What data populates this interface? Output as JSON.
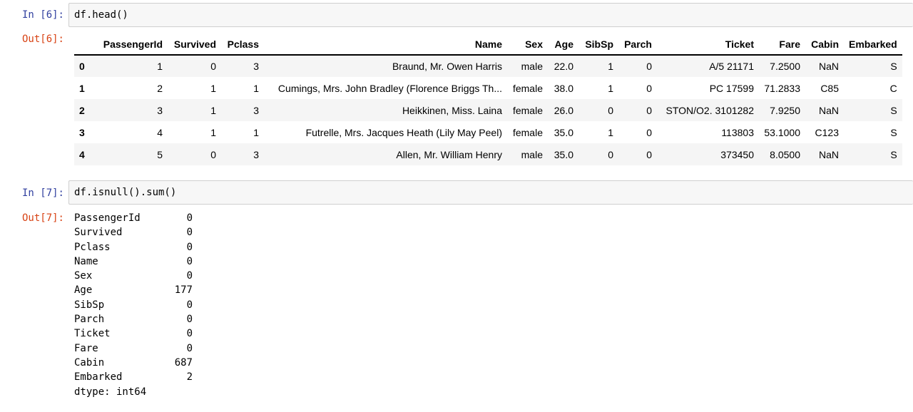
{
  "cells": [
    {
      "in_prompt": "In [6]:",
      "code": "df.head()",
      "out_prompt": "Out[6]:",
      "table": {
        "columns": [
          "",
          "PassengerId",
          "Survived",
          "Pclass",
          "Name",
          "Sex",
          "Age",
          "SibSp",
          "Parch",
          "Ticket",
          "Fare",
          "Cabin",
          "Embarked"
        ],
        "rows": [
          [
            "0",
            "1",
            "0",
            "3",
            "Braund, Mr. Owen Harris",
            "male",
            "22.0",
            "1",
            "0",
            "A/5 21171",
            "7.2500",
            "NaN",
            "S"
          ],
          [
            "1",
            "2",
            "1",
            "1",
            "Cumings, Mrs. John Bradley (Florence Briggs Th...",
            "female",
            "38.0",
            "1",
            "0",
            "PC 17599",
            "71.2833",
            "C85",
            "C"
          ],
          [
            "2",
            "3",
            "1",
            "3",
            "Heikkinen, Miss. Laina",
            "female",
            "26.0",
            "0",
            "0",
            "STON/O2. 3101282",
            "7.9250",
            "NaN",
            "S"
          ],
          [
            "3",
            "4",
            "1",
            "1",
            "Futrelle, Mrs. Jacques Heath (Lily May Peel)",
            "female",
            "35.0",
            "1",
            "0",
            "113803",
            "53.1000",
            "C123",
            "S"
          ],
          [
            "4",
            "5",
            "0",
            "3",
            "Allen, Mr. William Henry",
            "male",
            "35.0",
            "0",
            "0",
            "373450",
            "8.0500",
            "NaN",
            "S"
          ]
        ]
      }
    },
    {
      "in_prompt": "In [7]:",
      "code": "df.isnull().sum()",
      "out_prompt": "Out[7]:",
      "series": [
        [
          "PassengerId",
          "0"
        ],
        [
          "Survived",
          "0"
        ],
        [
          "Pclass",
          "0"
        ],
        [
          "Name",
          "0"
        ],
        [
          "Sex",
          "0"
        ],
        [
          "Age",
          "177"
        ],
        [
          "SibSp",
          "0"
        ],
        [
          "Parch",
          "0"
        ],
        [
          "Ticket",
          "0"
        ],
        [
          "Fare",
          "0"
        ],
        [
          "Cabin",
          "687"
        ],
        [
          "Embarked",
          "2"
        ]
      ],
      "dtype": "dtype: int64"
    }
  ]
}
